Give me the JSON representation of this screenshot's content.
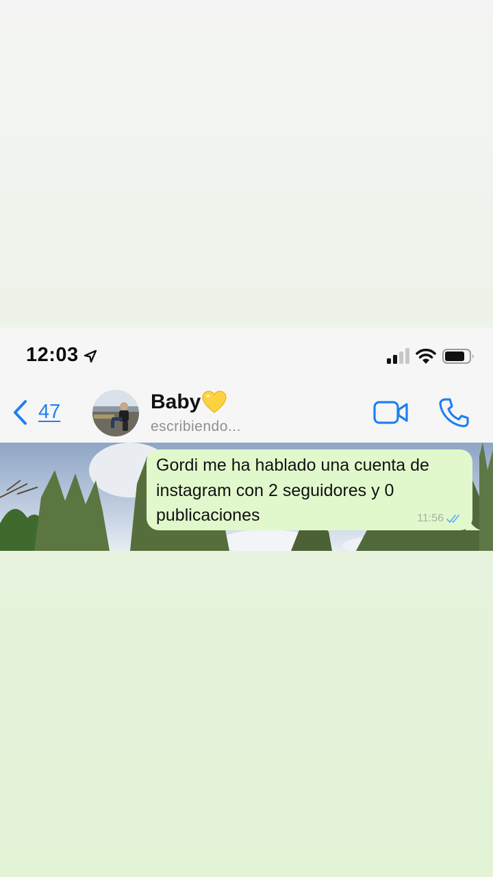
{
  "status_bar": {
    "time": "12:03",
    "icons": [
      "location-arrow-icon",
      "cellular-signal-icon",
      "wifi-icon",
      "battery-icon"
    ]
  },
  "header": {
    "back_count": "47",
    "contact_name": "Baby",
    "contact_emoji": "yellow-heart-icon",
    "contact_status": "escribiendo...",
    "icons": [
      "back-chevron-icon",
      "video-call-icon",
      "phone-icon"
    ],
    "accent_color": "#1f7ff0"
  },
  "messages": [
    {
      "direction": "outgoing",
      "text": "Gordi me ha hablado una cuenta de instagram con 2 seguidores y 0 publicaciones",
      "time": "11:56",
      "status": "read",
      "bubble_color": "#e1f8cc"
    }
  ]
}
